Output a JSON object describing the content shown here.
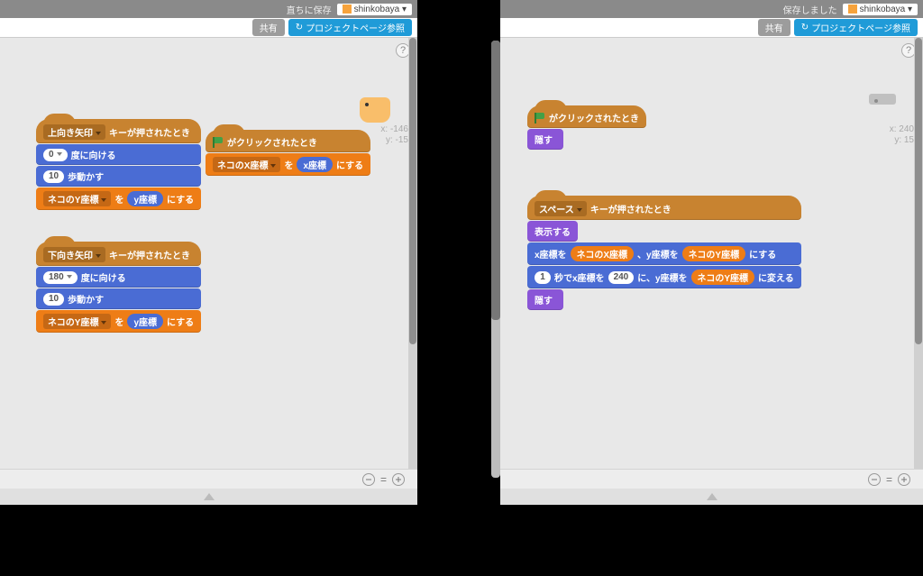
{
  "left": {
    "topbar": {
      "save_label": "直ちに保存",
      "username": "shinkobaya ▾"
    },
    "secondbar": {
      "share": "共有",
      "project_page": "プロジェクトページ参照"
    },
    "help": "?",
    "coords": {
      "x": "x: -146",
      "y": "y: -15"
    },
    "stacks": {
      "s1": {
        "hat_prefix": "上向き矢印",
        "hat_suffix": "キーが押されたとき",
        "point_deg": "0",
        "point_txt": "度に向ける",
        "move_n": "10",
        "move_txt": "歩動かす",
        "setvar_name": "ネコのY座標",
        "setvar_mid": "を",
        "setvar_val": "y座標",
        "setvar_end": "にする"
      },
      "s2": {
        "hat_flag_txt": "がクリックされたとき",
        "setvar_name": "ネコのX座標",
        "setvar_mid": "を",
        "setvar_val": "x座標",
        "setvar_end": "にする"
      },
      "s3": {
        "hat_prefix": "下向き矢印",
        "hat_suffix": "キーが押されたとき",
        "point_deg": "180",
        "point_txt": "度に向ける",
        "move_n": "10",
        "move_txt": "歩動かす",
        "setvar_name": "ネコのY座標",
        "setvar_mid": "を",
        "setvar_val": "y座標",
        "setvar_end": "にする"
      }
    },
    "zoom_eq": "="
  },
  "right": {
    "topbar": {
      "save_label": "保存しました",
      "username": "shinkobaya ▾"
    },
    "secondbar": {
      "share": "共有",
      "project_page": "プロジェクトページ参照"
    },
    "help": "?",
    "coords": {
      "x": "x: 240",
      "y": "y: 15"
    },
    "stacks": {
      "r1": {
        "hat_flag_txt": "がクリックされたとき",
        "hide": "隠す"
      },
      "r2": {
        "hat_prefix": "スペース",
        "hat_suffix": "キーが押されたとき",
        "show": "表示する",
        "goto_pre": "x座標を",
        "goto_x": "ネコのX座標",
        "goto_mid": "、y座標を",
        "goto_y": "ネコのY座標",
        "goto_end": "にする",
        "glide_sec": "1",
        "glide_a": "秒でx座標を",
        "glide_x": "240",
        "glide_b": "に、y座標を",
        "glide_y": "ネコのY座標",
        "glide_c": "に変える",
        "hide": "隠す"
      }
    },
    "zoom_eq": "="
  }
}
